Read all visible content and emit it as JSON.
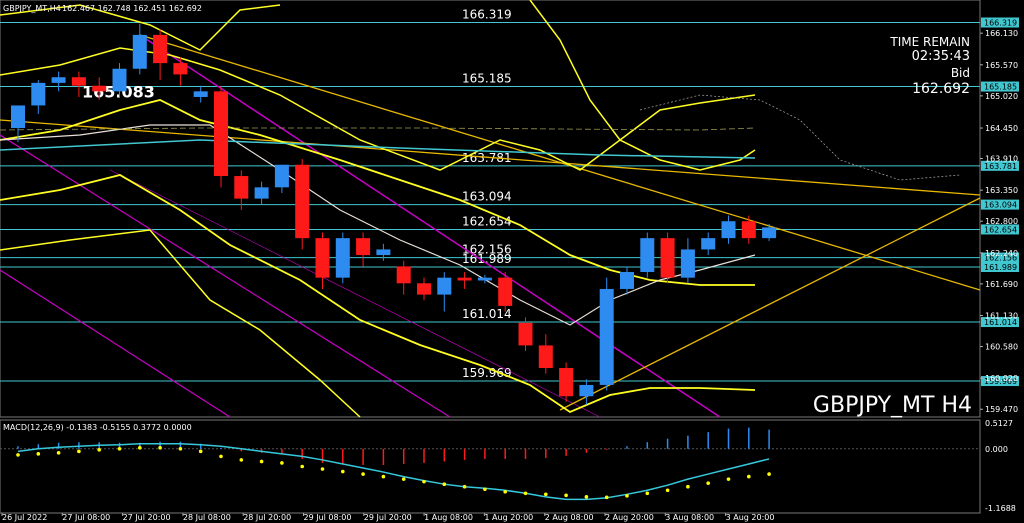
{
  "header": {
    "symbol_text": "GBPJPY_MT,H4",
    "ohlc_text": "162.467 162.748 162.451 162.692",
    "macd_text": "MACD(12,26,9) -0.1383 -0.5155 0.3772 0.0000"
  },
  "info": {
    "time_remain_label": "TIME REMAIN",
    "time_remain_value": "02:35:43",
    "bid_label": "Bid",
    "bid_value": "162.692",
    "watermark": "GBPJPY_MT H4"
  },
  "colors": {
    "background": "#000000",
    "bull": "#2e8cf0",
    "bear": "#ff1a1a",
    "level_line": "#41c7d0",
    "band": "#ffff22",
    "channel": "#c800c8",
    "trend": "#e8b800",
    "macd_signal": "#36c8dc",
    "macd_dots": "#ffff00"
  },
  "chart_data": [
    {
      "type": "candlestick",
      "price_range": [
        159.35,
        166.7
      ],
      "levels": [
        {
          "value": 166.319,
          "label": "166.319"
        },
        {
          "value": 165.185,
          "label": "165.185"
        },
        {
          "value": 163.781,
          "label": "163.781"
        },
        {
          "value": 163.094,
          "label": "163.094"
        },
        {
          "value": 162.654,
          "label": "162.654"
        },
        {
          "value": 162.156,
          "label": "162.156"
        },
        {
          "value": 161.989,
          "label": "161.989"
        },
        {
          "value": 161.014,
          "label": "161.014"
        },
        {
          "value": 159.969,
          "label": "159.969"
        }
      ],
      "highlight_label": {
        "value": 165.083,
        "label": "165.083"
      },
      "y_ticks": [
        "166.130",
        "165.570",
        "165.020",
        "164.450",
        "163.910",
        "163.350",
        "162.800",
        "162.240",
        "161.690",
        "161.130",
        "160.580",
        "160.020",
        "159.470"
      ],
      "y_tick_values": [
        166.13,
        165.57,
        165.02,
        164.45,
        163.91,
        163.35,
        162.8,
        162.24,
        161.69,
        161.13,
        160.58,
        160.02,
        159.47
      ],
      "x_ticks": [
        "26 Jul 2022",
        "27 Jul 08:00",
        "27 Jul 20:00",
        "28 Jul 08:00",
        "28 Jul 20:00",
        "29 Jul 08:00",
        "29 Jul 20:00",
        "1 Aug 08:00",
        "1 Aug 20:00",
        "2 Aug 08:00",
        "2 Aug 20:00",
        "3 Aug 08:00",
        "3 Aug 20:00"
      ],
      "candles": [
        {
          "o": 164.45,
          "h": 164.8,
          "c": 164.85,
          "l": 164.2
        },
        {
          "o": 164.85,
          "h": 165.3,
          "c": 165.25,
          "l": 164.7
        },
        {
          "o": 165.25,
          "h": 165.45,
          "c": 165.35,
          "l": 165.1
        },
        {
          "o": 165.35,
          "h": 165.45,
          "c": 165.2,
          "l": 165.0
        },
        {
          "o": 165.2,
          "h": 165.35,
          "c": 165.1,
          "l": 164.95
        },
        {
          "o": 165.1,
          "h": 165.6,
          "c": 165.5,
          "l": 165.0
        },
        {
          "o": 165.5,
          "h": 166.3,
          "c": 166.1,
          "l": 165.4
        },
        {
          "o": 166.1,
          "h": 166.2,
          "c": 165.6,
          "l": 165.3
        },
        {
          "o": 165.6,
          "h": 165.7,
          "c": 165.4,
          "l": 165.2
        },
        {
          "o": 165.0,
          "h": 165.2,
          "c": 165.1,
          "l": 164.9
        },
        {
          "o": 165.1,
          "h": 165.2,
          "c": 163.6,
          "l": 163.4
        },
        {
          "o": 163.6,
          "h": 163.7,
          "c": 163.2,
          "l": 163.0
        },
        {
          "o": 163.2,
          "h": 163.5,
          "c": 163.4,
          "l": 163.1
        },
        {
          "o": 163.4,
          "h": 163.8,
          "c": 163.8,
          "l": 163.3
        },
        {
          "o": 163.8,
          "h": 163.9,
          "c": 162.5,
          "l": 162.3
        },
        {
          "o": 162.5,
          "h": 162.6,
          "c": 161.8,
          "l": 161.6
        },
        {
          "o": 161.8,
          "h": 162.6,
          "c": 162.5,
          "l": 161.7
        },
        {
          "o": 162.5,
          "h": 162.6,
          "c": 162.2,
          "l": 162.0
        },
        {
          "o": 162.2,
          "h": 162.4,
          "c": 162.3,
          "l": 162.1
        },
        {
          "o": 162.0,
          "h": 162.1,
          "c": 161.7,
          "l": 161.5
        },
        {
          "o": 161.7,
          "h": 161.8,
          "c": 161.5,
          "l": 161.4
        },
        {
          "o": 161.5,
          "h": 161.9,
          "c": 161.8,
          "l": 161.2
        },
        {
          "o": 161.8,
          "h": 161.9,
          "c": 161.75,
          "l": 161.6
        },
        {
          "o": 161.75,
          "h": 161.85,
          "c": 161.8,
          "l": 161.7
        },
        {
          "o": 161.8,
          "h": 161.9,
          "c": 161.3,
          "l": 161.2
        },
        {
          "o": 161.0,
          "h": 161.1,
          "c": 160.6,
          "l": 160.5
        },
        {
          "o": 160.6,
          "h": 160.8,
          "c": 160.2,
          "l": 160.1
        },
        {
          "o": 160.2,
          "h": 160.3,
          "c": 159.7,
          "l": 159.6
        },
        {
          "o": 159.7,
          "h": 160.0,
          "c": 159.9,
          "l": 159.55
        },
        {
          "o": 159.9,
          "h": 161.8,
          "c": 161.6,
          "l": 159.8
        },
        {
          "o": 161.6,
          "h": 162.0,
          "c": 161.9,
          "l": 161.5
        },
        {
          "o": 161.9,
          "h": 162.6,
          "c": 162.5,
          "l": 161.8
        },
        {
          "o": 162.5,
          "h": 162.6,
          "c": 161.8,
          "l": 161.7
        },
        {
          "o": 161.8,
          "h": 162.5,
          "c": 162.3,
          "l": 161.7
        },
        {
          "o": 162.3,
          "h": 162.6,
          "c": 162.5,
          "l": 162.2
        },
        {
          "o": 162.5,
          "h": 162.9,
          "c": 162.8,
          "l": 162.4
        },
        {
          "o": 162.8,
          "h": 162.9,
          "c": 162.5,
          "l": 162.4
        },
        {
          "o": 162.5,
          "h": 162.75,
          "c": 162.69,
          "l": 162.45
        }
      ],
      "macd": {
        "range": [
          -1.25,
          0.55
        ],
        "y_ticks": [
          "0.5127",
          "0.000",
          "-1.1688"
        ],
        "y_tick_values": [
          0.5127,
          0.0,
          -1.1688
        ],
        "histogram": [
          0.05,
          0.09,
          0.12,
          0.13,
          0.13,
          0.12,
          0.12,
          0.14,
          0.14,
          0.1,
          0.02,
          -0.05,
          -0.08,
          -0.1,
          -0.2,
          -0.28,
          -0.3,
          -0.32,
          -0.32,
          -0.3,
          -0.28,
          -0.25,
          -0.22,
          -0.2,
          -0.2,
          -0.2,
          -0.18,
          -0.14,
          -0.08,
          -0.02,
          0.05,
          0.13,
          0.2,
          0.26,
          0.33,
          0.4,
          0.42,
          0.38
        ],
        "signal": [
          -0.05,
          0.0,
          0.03,
          0.05,
          0.07,
          0.08,
          0.1,
          0.1,
          0.1,
          0.08,
          0.05,
          0.0,
          -0.05,
          -0.1,
          -0.15,
          -0.22,
          -0.3,
          -0.38,
          -0.46,
          -0.55,
          -0.63,
          -0.7,
          -0.75,
          -0.78,
          -0.82,
          -0.88,
          -0.95,
          -1.0,
          -1.0,
          -0.97,
          -0.9,
          -0.82,
          -0.72,
          -0.6,
          -0.5,
          -0.4,
          -0.3,
          -0.2
        ],
        "dots": [
          -0.12,
          -0.1,
          -0.08,
          -0.05,
          -0.02,
          0.0,
          0.02,
          0.02,
          0.0,
          -0.05,
          -0.15,
          -0.22,
          -0.25,
          -0.28,
          -0.35,
          -0.4,
          -0.45,
          -0.5,
          -0.55,
          -0.6,
          -0.65,
          -0.7,
          -0.75,
          -0.8,
          -0.85,
          -0.88,
          -0.9,
          -0.92,
          -0.95,
          -0.96,
          -0.93,
          -0.88,
          -0.82,
          -0.75,
          -0.68,
          -0.6,
          -0.55,
          -0.5
        ]
      }
    }
  ]
}
